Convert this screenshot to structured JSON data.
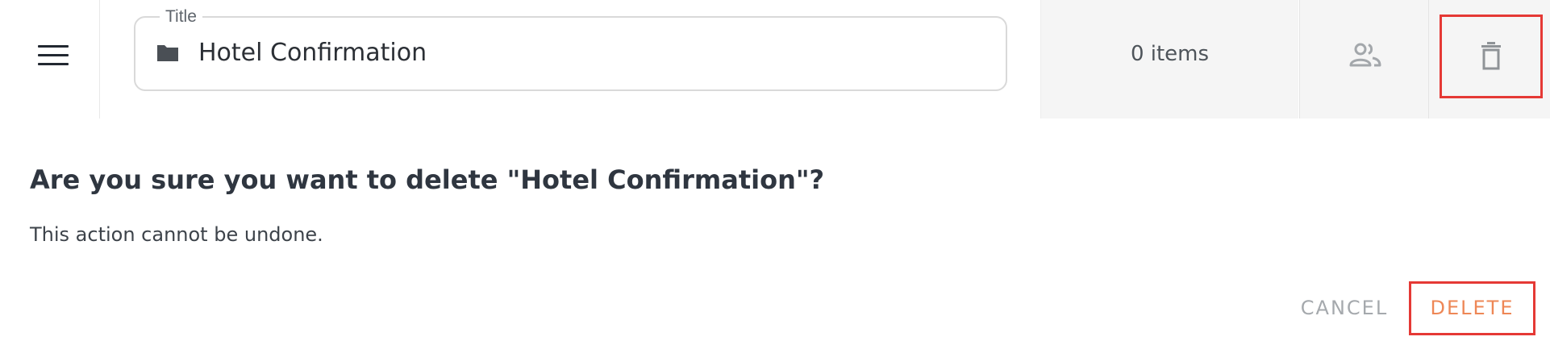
{
  "toolbar": {
    "menu_icon": "hamburger-menu-icon",
    "title_field": {
      "label": "Title",
      "value": "Hotel Confirmation",
      "icon": "folder-icon"
    },
    "item_count": "0 items",
    "share_icon": "people-icon",
    "delete_icon": "trash-icon"
  },
  "dialog": {
    "title": "Are you sure you want to delete \"Hotel Confirmation\"?",
    "message": "This action cannot be undone.",
    "cancel_label": "CANCEL",
    "delete_label": "DELETE"
  },
  "colors": {
    "highlight_border": "#e53935",
    "delete_text": "#ee8756",
    "cancel_text": "#a5a9ad",
    "panel_background": "#f5f5f5"
  }
}
